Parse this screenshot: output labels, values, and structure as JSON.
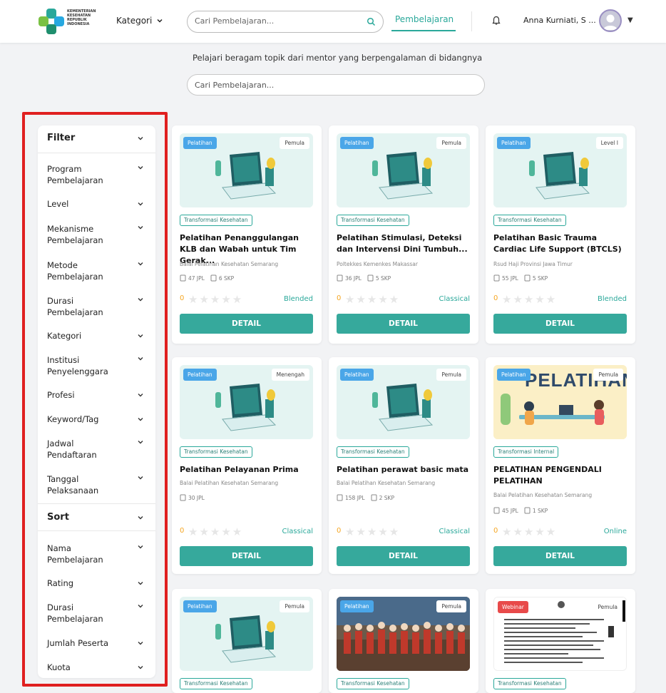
{
  "header": {
    "logo_lines": [
      "KEMENTERIAN",
      "KESEHATAN",
      "REPUBLIK",
      "INDONESIA"
    ],
    "kategori_label": "Kategori",
    "search_placeholder": "Cari Pembelajaran...",
    "nav_active": "Pembelajaran",
    "user_name": "Anna Kurniati, S ..."
  },
  "intro": {
    "tagline": "Pelajari beragam topik dari mentor yang berpengalaman di bidangnya",
    "search_placeholder": "Cari Pembelajaran..."
  },
  "filter": {
    "filter_title": "Filter",
    "filter_items": [
      "Program Pembelajaran",
      "Level",
      "Mekanisme Pembelajaran",
      "Metode Pembelajaran",
      "Durasi Pembelajaran",
      "Kategori",
      "Institusi Penyelenggara",
      "Profesi",
      "Keyword/Tag",
      "Jadwal Pendaftaran",
      "Tanggal Pelaksanaan"
    ],
    "sort_title": "Sort",
    "sort_items": [
      "Nama Pembelajaran",
      "Rating",
      "Durasi Pembelajaran",
      "Jumlah Peserta",
      "Kuota"
    ]
  },
  "cards": [
    {
      "type": "Pelatihan",
      "level": "Pemula",
      "tag": "Transformasi Kesehatan",
      "title": "Pelatihan Penanggulangan KLB dan Wabah untuk Tim Gerak...",
      "institution": "Balai Pelatihan Kesehatan Semarang",
      "jpl": "47 JPL",
      "skp": "6 SKP",
      "rating": "0",
      "mechanism": "Blended",
      "button": "DETAIL"
    },
    {
      "type": "Pelatihan",
      "level": "Pemula",
      "tag": "Transformasi Kesehatan",
      "title": "Pelatihan Stimulasi, Deteksi dan Intervensi Dini Tumbuh...",
      "institution": "Poltekkes Kemenkes Makassar",
      "jpl": "36 JPL",
      "skp": "5 SKP",
      "rating": "0",
      "mechanism": "Classical",
      "button": "DETAIL"
    },
    {
      "type": "Pelatihan",
      "level": "Level I",
      "tag": "Transformasi Kesehatan",
      "title": "Pelatihan Basic Trauma Cardiac Life Support (BTCLS)",
      "institution": "Rsud Haji Provinsi Jawa Timur",
      "jpl": "55 JPL",
      "skp": "5 SKP",
      "rating": "0",
      "mechanism": "Blended",
      "button": "DETAIL"
    },
    {
      "type": "Pelatihan",
      "level": "Menengah",
      "tag": "Transformasi Kesehatan",
      "title": "Pelatihan Pelayanan Prima",
      "institution": "Balai Pelatihan Kesehatan Semarang",
      "jpl": "30 JPL",
      "skp": "",
      "rating": "0",
      "mechanism": "Classical",
      "button": "DETAIL"
    },
    {
      "type": "Pelatihan",
      "level": "Pemula",
      "tag": "Transformasi Kesehatan",
      "title": "Pelatihan perawat basic mata",
      "institution": "Balai Pelatihan Kesehatan Semarang",
      "jpl": "158 JPL",
      "skp": "2 SKP",
      "rating": "0",
      "mechanism": "Classical",
      "button": "DETAIL"
    },
    {
      "type": "Pelatihan",
      "level": "Pemula",
      "tag": "Transformasi Internal",
      "title": "PELATIHAN PENGENDALI PELATIHAN",
      "institution": "Balai Pelatihan Kesehatan Semarang",
      "jpl": "45 JPL",
      "skp": "1 SKP",
      "rating": "0",
      "mechanism": "Online",
      "button": "DETAIL",
      "banner_text": "PELATIHAN"
    },
    {
      "type": "Pelatihan",
      "level": "Pemula",
      "tag": "Transformasi Kesehatan"
    },
    {
      "type": "Pelatihan",
      "level": "Pemula",
      "tag": "Transformasi Kesehatan"
    },
    {
      "type": "Webinar",
      "level": "Pemula",
      "tag": "Transformasi Kesehatan"
    }
  ],
  "colors": {
    "accent": "#2aa89a",
    "button": "#36a99c",
    "badge_blue": "#4aa6e8",
    "badge_red": "#e84a4a",
    "star": "#f5a623",
    "highlight": "#e02020"
  }
}
